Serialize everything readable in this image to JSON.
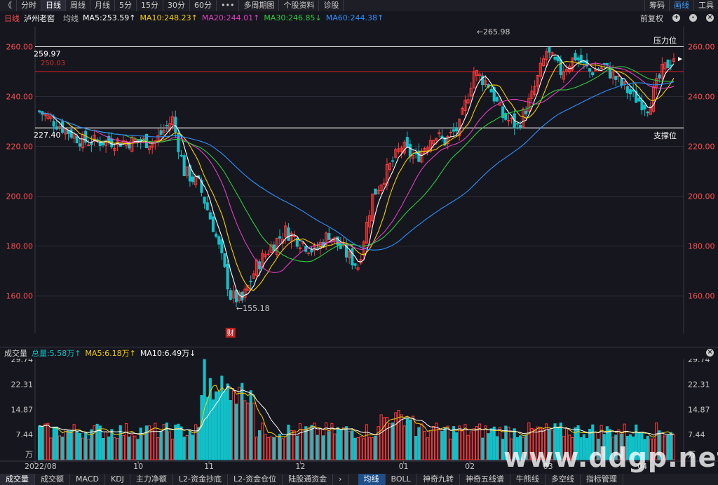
{
  "toolbar": {
    "back": "《",
    "tabs": [
      "分时",
      "日线",
      "周线",
      "月线",
      "5分",
      "15分",
      "30分",
      "60分",
      "•••",
      "多周期图",
      "个股资料",
      "诊股"
    ],
    "active_tab": "日线",
    "right": [
      "筹码",
      "画线",
      "工具"
    ],
    "right_active": "画线"
  },
  "mabar": {
    "period": "日线",
    "name": "泸州老窖",
    "avg": "均线",
    "ma5": "MA5:253.59↑",
    "ma10": "MA10:248.23↑",
    "ma20": "MA20:244.01↑",
    "ma30": "MA30:246.85↓",
    "ma60": "MA60:244.38↑",
    "adjust": "前复权",
    "btn_add": "+",
    "btn_minus": "-",
    "btn_close": "×"
  },
  "volbar": {
    "label": "成交量",
    "total": "总量:5.58万↑",
    "ma5": "MA5:6.18万↑",
    "ma10": "MA10:6.49万↓"
  },
  "bottomtabs": {
    "left": [
      "成交量",
      "成交额",
      "MACD",
      "KDJ",
      "主力净额",
      "L2-资金抄底",
      "L2-资金仓位",
      "陆股通资金"
    ],
    "left_active": "成交量",
    "arrow": "›",
    "right": [
      "均线",
      "BOLL",
      "神奇九转",
      "神奇五线谱",
      "牛熊线",
      "多空线",
      "指标管理"
    ],
    "right_active": "均线"
  },
  "annotations": {
    "pressure": "压力位",
    "support": "支撑位",
    "pressure_value": "259.97",
    "red_value": "250.03",
    "support_value": "227.40",
    "high": "265.98",
    "low": "155.18",
    "fin_badge": "财"
  },
  "watermark": "www.ddgp.net",
  "colors": {
    "up": "#ff3a3a",
    "down": "#12c0c8",
    "ma5": "#ffffff",
    "ma10": "#f5d000",
    "ma20": "#e040c0",
    "ma30": "#2ecc40",
    "ma60": "#2e90ff"
  },
  "chart_data": [
    {
      "type": "candlestick",
      "title": "泸州老窖 日线",
      "ylabel": "",
      "y_ticks": [
        "260.00",
        "240.00",
        "220.00",
        "200.00",
        "180.00",
        "160.00"
      ],
      "ylim": [
        145,
        268
      ],
      "x_ticks": [
        "2022/08",
        "10",
        "11",
        "12",
        "01",
        "02",
        "03",
        "04"
      ],
      "close_anchors": {
        "x_index": [
          0,
          15,
          20,
          30,
          40,
          46,
          50,
          55,
          60,
          63,
          66,
          70,
          75,
          80,
          85,
          90,
          95,
          100,
          105,
          110,
          115,
          120,
          125,
          130,
          136,
          140,
          145,
          150,
          152,
          155,
          160,
          165,
          170,
          175,
          180,
          185,
          190,
          195,
          200,
          205,
          210,
          215,
          219
        ],
        "close": [
          234,
          222,
          222,
          222,
          222,
          231,
          210,
          205,
          188,
          175,
          160,
          158,
          172,
          180,
          186,
          182,
          178,
          185,
          178,
          172,
          200,
          210,
          220,
          215,
          225,
          222,
          228,
          250,
          248,
          245,
          232,
          228,
          240,
          258,
          250,
          256,
          250,
          252,
          246,
          240,
          236,
          250,
          256
        ]
      },
      "levels": {
        "pressure": 259.97,
        "red_line": 250.03,
        "support": 227.4
      },
      "annotated_high": 265.98,
      "annotated_low": 155.18
    },
    {
      "type": "bar",
      "title": "成交量",
      "y_ticks": [
        "29.74",
        "22.31",
        "14.87",
        "7.44"
      ],
      "y_unit": "万",
      "ylim": [
        0,
        29.74
      ]
    }
  ]
}
